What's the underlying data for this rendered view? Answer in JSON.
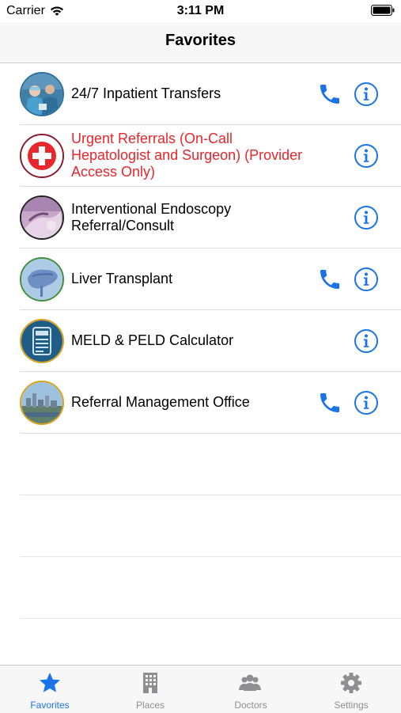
{
  "status_bar": {
    "carrier": "Carrier",
    "time": "3:11 PM"
  },
  "nav": {
    "title": "Favorites"
  },
  "rows": [
    {
      "label": "24/7 Inpatient Transfers",
      "has_phone": true,
      "icon": "doctors-photo"
    },
    {
      "label": "Urgent Referrals (On-Call Hepatologist and Surgeon) (Provider Access Only)",
      "has_phone": false,
      "icon": "red-cross-icon"
    },
    {
      "label": "Interventional Endoscopy Referral/Consult",
      "has_phone": false,
      "icon": "endoscopy-photo"
    },
    {
      "label": "Liver Transplant",
      "has_phone": true,
      "icon": "liver-icon"
    },
    {
      "label": "MELD & PELD Calculator",
      "has_phone": false,
      "icon": "calculator-icon"
    },
    {
      "label": "Referral Management Office",
      "has_phone": true,
      "icon": "city-skyline-photo"
    }
  ],
  "tabs": [
    {
      "label": "Favorites",
      "icon": "star-icon",
      "active": true
    },
    {
      "label": "Places",
      "icon": "building-icon",
      "active": false
    },
    {
      "label": "Doctors",
      "icon": "people-icon",
      "active": false
    },
    {
      "label": "Settings",
      "icon": "gear-icon",
      "active": false
    }
  ],
  "colors": {
    "accent": "#1a73e8",
    "urgent_text": "#e8262b",
    "tab_inactive": "#8e8e93"
  }
}
